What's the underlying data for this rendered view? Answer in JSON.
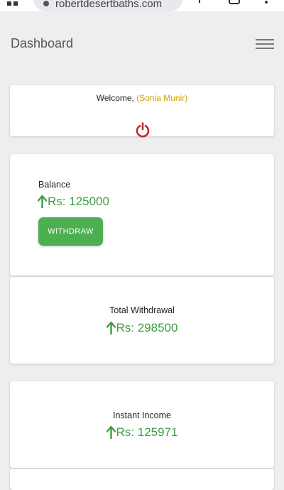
{
  "browser": {
    "url": "robertdesertbaths.com"
  },
  "header": {
    "title": "Dashboard"
  },
  "welcome": {
    "prefix": "Welcome, ",
    "username": "(Sonia Munir)"
  },
  "balance": {
    "label": "Balance",
    "amount": "Rs: 125000",
    "withdraw_label": "WITHDRAW"
  },
  "total_withdrawal": {
    "label": "Total Withdrawal",
    "amount": "Rs: 298500"
  },
  "instant_income": {
    "label": "Instant Income",
    "amount": "Rs: 125971"
  },
  "colors": {
    "accent_green": "#4caf50",
    "amount_green": "#3f9b45",
    "username_gold": "#c9a400",
    "power_red": "#c62828"
  },
  "icons": [
    "tabs-icon",
    "lock-icon",
    "share-icon",
    "tab-count-icon",
    "kebab-menu-icon",
    "hamburger-menu-icon",
    "power-icon",
    "up-arrow-icon"
  ]
}
